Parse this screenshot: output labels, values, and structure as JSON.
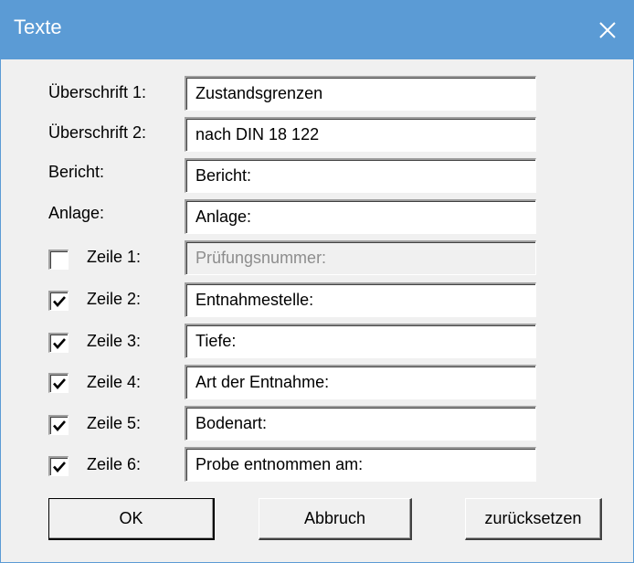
{
  "window": {
    "title": "Texte",
    "close_icon": "close-icon",
    "accent": "#5b9bd5"
  },
  "fields": [
    {
      "label": "Überschrift 1:",
      "value": "Zustandsgrenzen"
    },
    {
      "label": "Überschrift 2:",
      "value": "nach DIN 18 122"
    },
    {
      "label": "Bericht:",
      "value": "Bericht:"
    },
    {
      "label": "Anlage:",
      "value": "Anlage:"
    }
  ],
  "rows": [
    {
      "label": "Zeile 1:",
      "checked": false,
      "value": "Prüfungsnummer:",
      "enabled": false
    },
    {
      "label": "Zeile 2:",
      "checked": true,
      "value": "Entnahmestelle:",
      "enabled": true
    },
    {
      "label": "Zeile 3:",
      "checked": true,
      "value": "Tiefe:",
      "enabled": true
    },
    {
      "label": "Zeile 4:",
      "checked": true,
      "value": "Art der Entnahme:",
      "enabled": true
    },
    {
      "label": "Zeile 5:",
      "checked": true,
      "value": "Bodenart:",
      "enabled": true
    },
    {
      "label": "Zeile 6:",
      "checked": true,
      "value": "Probe entnommen am:",
      "enabled": true
    }
  ],
  "buttons": {
    "ok": "OK",
    "cancel": "Abbruch",
    "reset": "zurücksetzen"
  }
}
